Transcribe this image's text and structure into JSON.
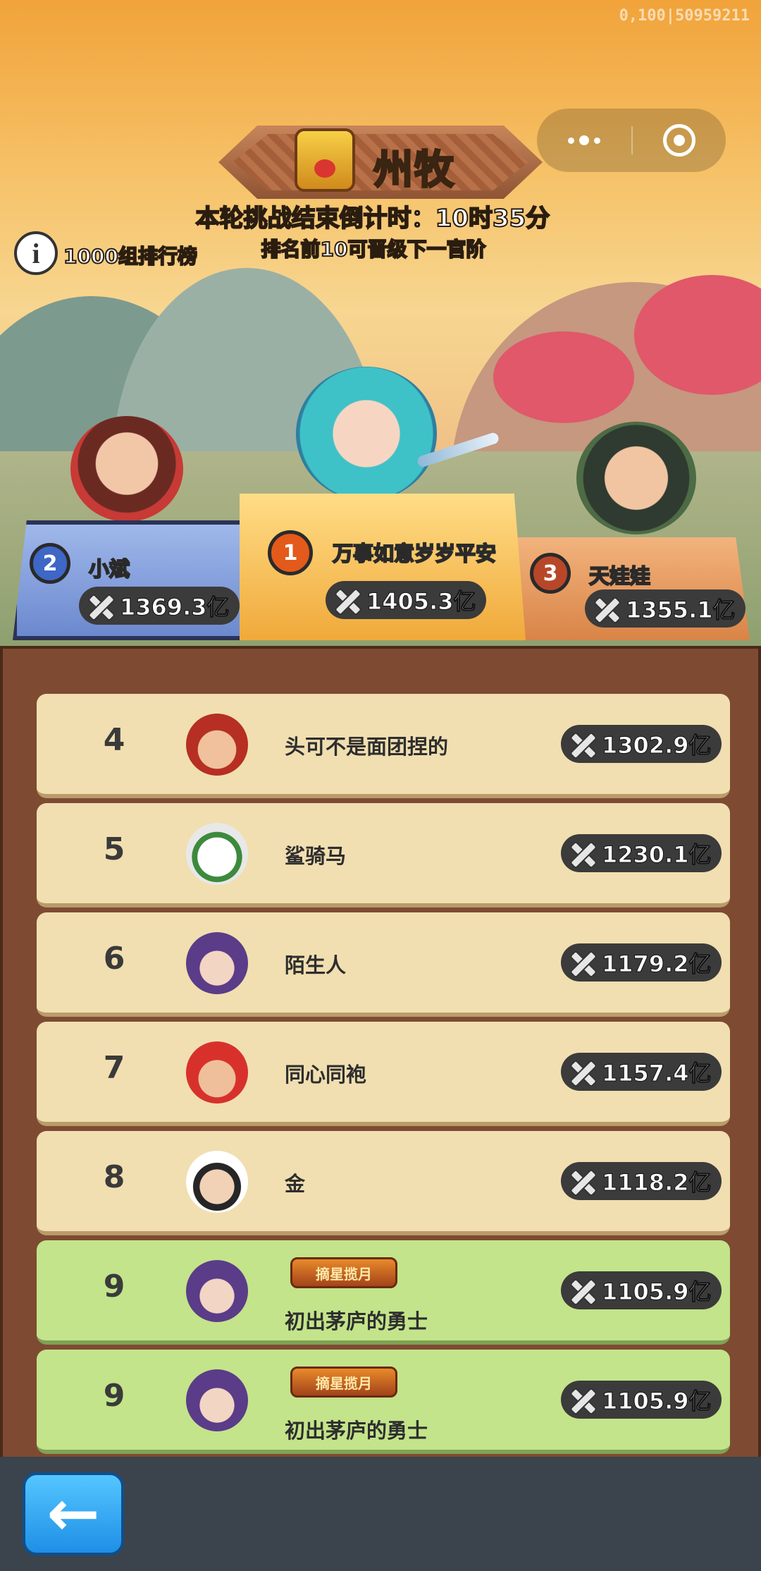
{
  "debug_text": "0,100|50959211",
  "rank_title": "州牧",
  "countdown": "本轮挑战结束倒计时：10时35分",
  "promo": "排名前10可晋级下一官阶",
  "info_label": "1000组排行榜",
  "podium": {
    "first": {
      "rank": "1",
      "name": "万事如意岁岁平安",
      "power": "1405.3亿"
    },
    "second": {
      "rank": "2",
      "name": "小斌",
      "power": "1369.3亿"
    },
    "third": {
      "rank": "3",
      "name": "天娃娃",
      "power": "1355.1亿"
    }
  },
  "rows": [
    {
      "rank": "4",
      "name": "头可不是面团捏的",
      "power": "1302.9亿",
      "badge": ""
    },
    {
      "rank": "5",
      "name": "鲨骑马",
      "power": "1230.1亿",
      "badge": ""
    },
    {
      "rank": "6",
      "name": "陌生人",
      "power": "1179.2亿",
      "badge": ""
    },
    {
      "rank": "7",
      "name": "同心同袍",
      "power": "1157.4亿",
      "badge": ""
    },
    {
      "rank": "8",
      "name": "金",
      "power": "1118.2亿",
      "badge": ""
    },
    {
      "rank": "9",
      "name": "初出茅庐的勇士",
      "power": "1105.9亿",
      "badge": "摘星揽月"
    },
    {
      "rank": "9",
      "name": "初出茅庐的勇士",
      "power": "1105.9亿",
      "badge": "摘星揽月"
    }
  ],
  "back_icon": "←"
}
